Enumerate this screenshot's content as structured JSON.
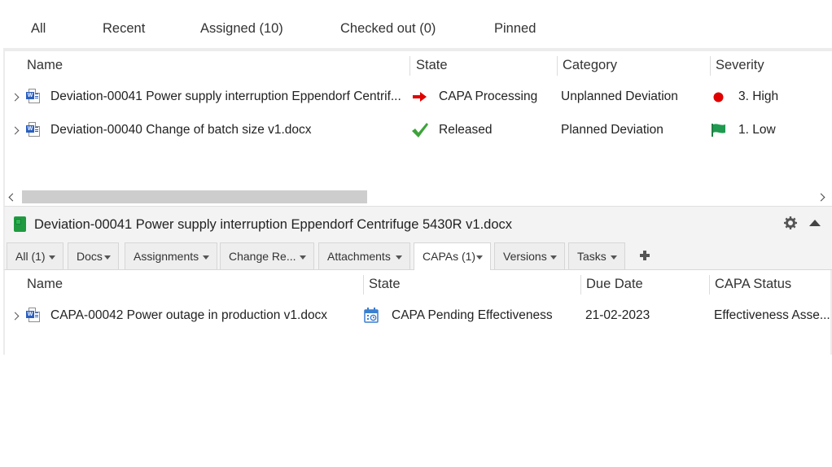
{
  "top_tabs": [
    {
      "label": "All"
    },
    {
      "label": "Recent"
    },
    {
      "label": "Assigned (10)"
    },
    {
      "label": "Checked out (0)"
    },
    {
      "label": "Pinned"
    }
  ],
  "main_grid": {
    "columns": [
      "Name",
      "State",
      "Category",
      "Severity"
    ],
    "rows": [
      {
        "name": "Deviation-00041 Power supply interruption Eppendorf Centrif...",
        "file_icon": "word-doc-icon",
        "state": "CAPA Processing",
        "state_icon": "red-arrow-right-icon",
        "category": "Unplanned Deviation",
        "severity": "3. High",
        "severity_icon": "red-dot-icon"
      },
      {
        "name": "Deviation-00040 Change of batch size v1.docx",
        "file_icon": "word-doc-icon",
        "state": "Released",
        "state_icon": "green-check-icon",
        "category": "Planned Deviation",
        "severity": "1. Low",
        "severity_icon": "green-flag-icon"
      }
    ]
  },
  "detail": {
    "title": "Deviation-00041 Power supply interruption Eppendorf Centrifuge 5430R v1.docx",
    "tabs": [
      {
        "label": "All (1)"
      },
      {
        "label": "Docs"
      },
      {
        "label": "Assignments"
      },
      {
        "label": "Change Re..."
      },
      {
        "label": "Attachments"
      },
      {
        "label": "CAPAs (1)",
        "active": true
      },
      {
        "label": "Versions"
      },
      {
        "label": "Tasks"
      }
    ],
    "grid": {
      "columns": [
        "Name",
        "State",
        "Due Date",
        "CAPA Status"
      ],
      "rows": [
        {
          "name": "CAPA-00042 Power outage in production v1.docx",
          "file_icon": "word-doc-icon",
          "state": "CAPA Pending Effectiveness",
          "state_icon": "calendar-clock-icon",
          "due_date": "21-02-2023",
          "capa_status": "Effectiveness Asse..."
        }
      ]
    }
  },
  "colors": {
    "accent_red": "#e00000",
    "accent_green": "#1f9a3f",
    "word_blue": "#2b5fbf",
    "calendar_blue": "#3a7fd0"
  }
}
